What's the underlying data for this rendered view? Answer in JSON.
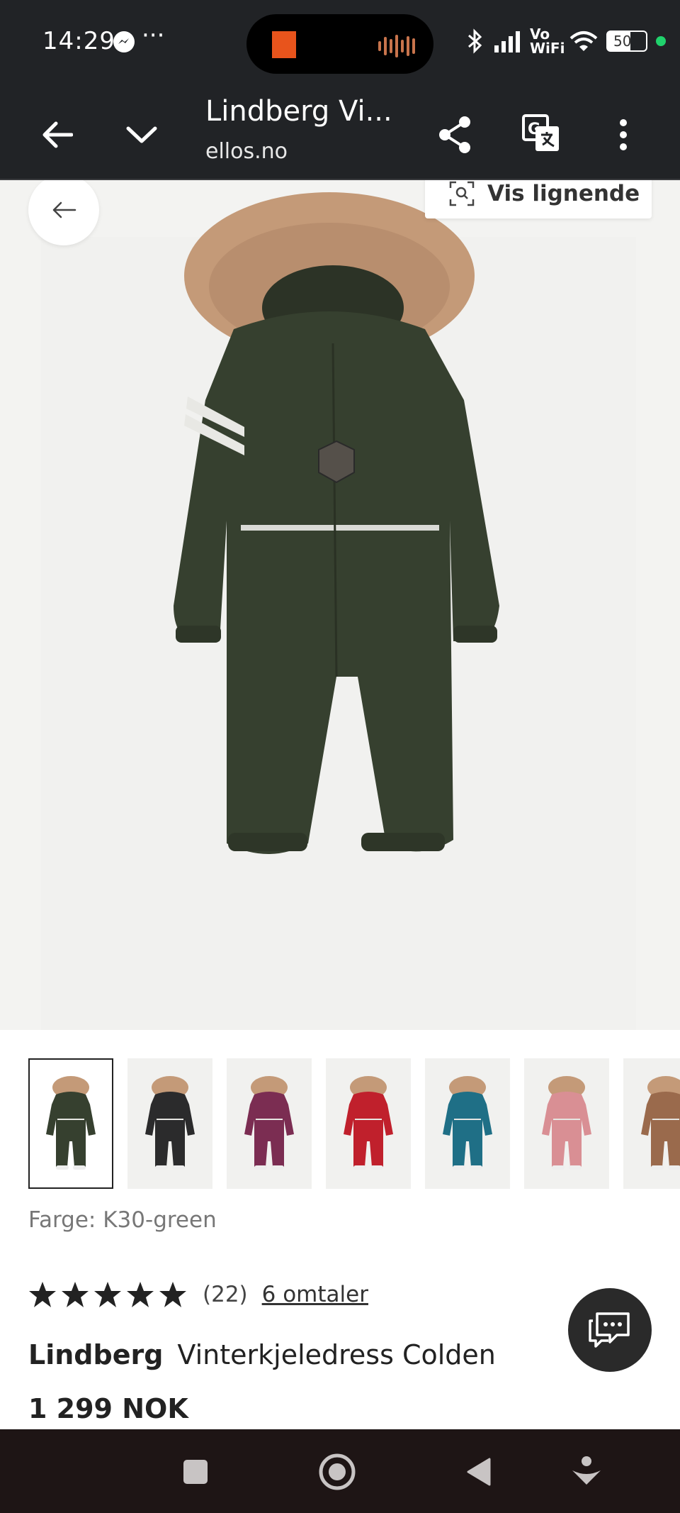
{
  "status_bar": {
    "time": "14:29",
    "network_label": "Vo WiFi",
    "battery_level": "50",
    "icons": [
      "messenger-icon",
      "more-dots-icon",
      "bluetooth-icon",
      "signal-icon",
      "wifi-icon",
      "battery-icon"
    ]
  },
  "browser": {
    "title": "Lindberg Vi...",
    "url": "ellos.no",
    "icons": [
      "back-arrow-icon",
      "chevron-down-icon",
      "share-icon",
      "translate-icon",
      "overflow-menu-icon"
    ]
  },
  "gallery": {
    "similar_button_label": "Vis lignende",
    "icons": [
      "gallery-back-icon",
      "visual-search-icon"
    ],
    "main_product_color": "#36402f"
  },
  "thumbnails": [
    {
      "color": "#36402f",
      "selected": true
    },
    {
      "color": "#2b2b2c",
      "selected": false
    },
    {
      "color": "#7b2d52",
      "selected": false
    },
    {
      "color": "#c0202c",
      "selected": false
    },
    {
      "color": "#1f6f86",
      "selected": false
    },
    {
      "color": "#d98f94",
      "selected": false
    },
    {
      "color": "#9a6a4c",
      "selected": false
    }
  ],
  "product": {
    "color_label": "Farge: K30-green",
    "rating_stars": 5,
    "rating_count": "(22)",
    "reviews_link": "6 omtaler",
    "brand": "Lindberg",
    "name": "Vinterkjeledress Colden",
    "price": "1 299 NOK"
  },
  "nav_bar": {
    "icons": [
      "recents-square-icon",
      "home-circle-icon",
      "back-triangle-icon",
      "download-assist-icon"
    ]
  }
}
